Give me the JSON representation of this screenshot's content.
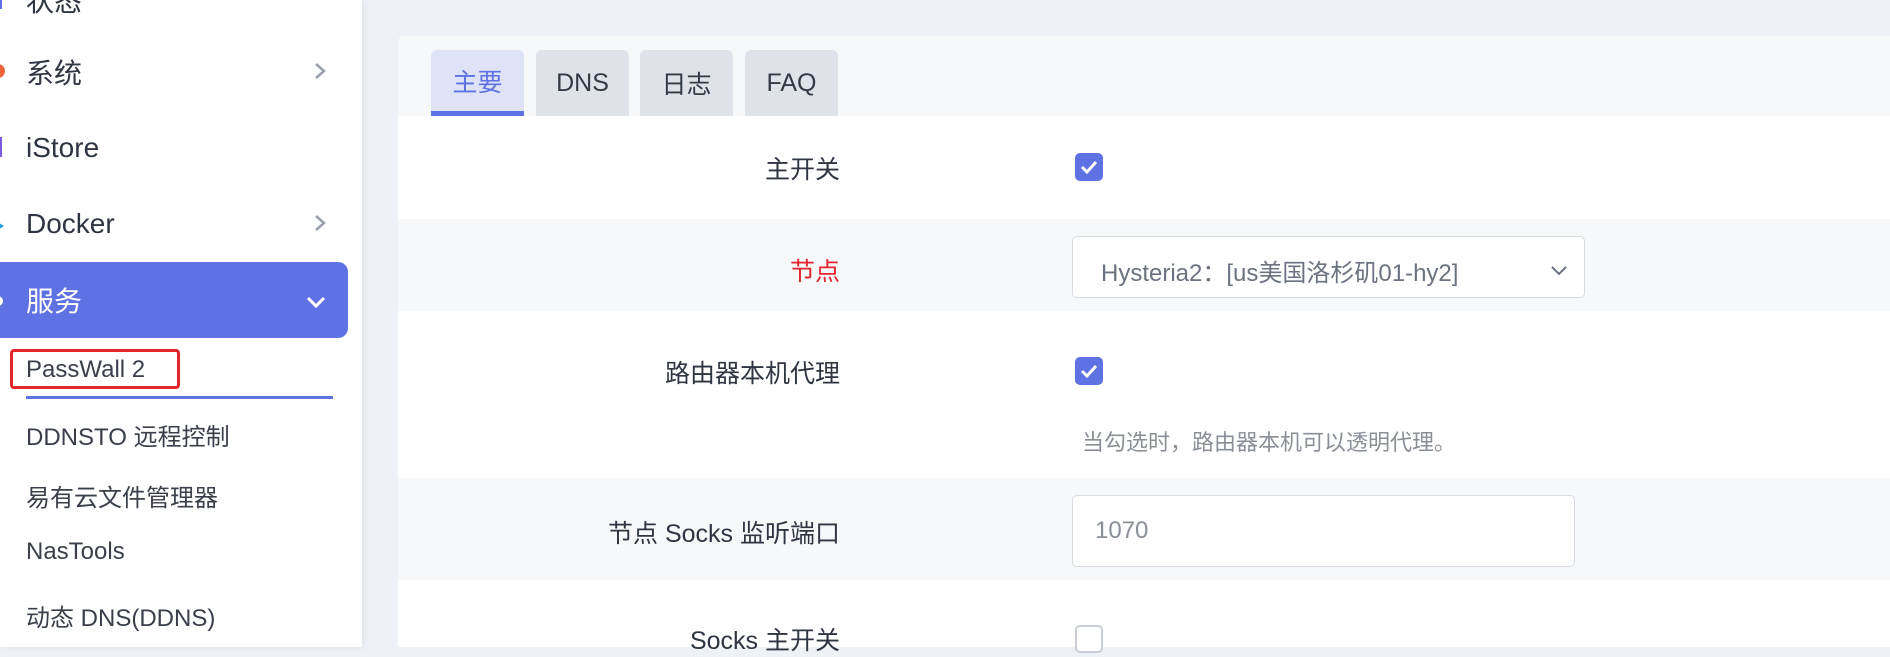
{
  "sidebar": {
    "items": [
      {
        "label": "状态",
        "icon": "status-icon"
      },
      {
        "label": "系统",
        "icon": "gear-icon"
      },
      {
        "label": "iStore",
        "icon": "store-icon"
      },
      {
        "label": "Docker",
        "icon": "docker-icon"
      },
      {
        "label": "服务",
        "icon": "services-icon"
      }
    ],
    "sub_items": [
      {
        "label": "PassWall 2"
      },
      {
        "label": "DDNSTO 远程控制"
      },
      {
        "label": "易有云文件管理器"
      },
      {
        "label": "NasTools"
      },
      {
        "label": "动态 DNS(DDNS)"
      }
    ]
  },
  "tabs": [
    {
      "label": "主要"
    },
    {
      "label": "DNS"
    },
    {
      "label": "日志"
    },
    {
      "label": "FAQ"
    }
  ],
  "form": {
    "main_switch": {
      "label": "主开关",
      "checked": true
    },
    "node": {
      "label": "节点",
      "value": "Hysteria2：[us美国洛杉矶01-hy2]"
    },
    "router_proxy": {
      "label": "路由器本机代理",
      "checked": true,
      "hint": "当勾选时，路由器本机可以透明代理。"
    },
    "socks_port": {
      "label": "节点 Socks 监听端口",
      "value": "1070"
    },
    "socks_switch": {
      "label": "Socks 主开关",
      "checked": false
    }
  },
  "colors": {
    "accent": "#5e72e4",
    "highlight": "#e3262e"
  }
}
